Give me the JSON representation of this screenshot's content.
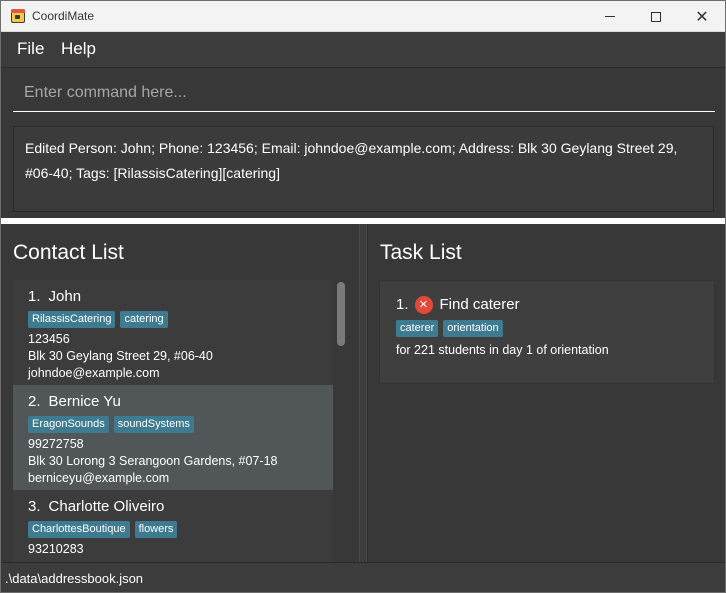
{
  "window": {
    "title": "CoordiMate",
    "icon": "calendar-app-icon"
  },
  "menu": {
    "items": [
      {
        "label": "File"
      },
      {
        "label": "Help"
      }
    ]
  },
  "command": {
    "placeholder": "Enter command here...",
    "value": ""
  },
  "result": {
    "text": "Edited Person: John; Phone: 123456; Email: johndoe@example.com; Address: Blk 30 Geylang Street 29, #06-40; Tags: [RilassisCatering][catering]"
  },
  "contacts": {
    "title": "Contact List",
    "items": [
      {
        "index": "1.",
        "name": "John",
        "tags": [
          "RilassisCatering",
          "catering"
        ],
        "phone": "123456",
        "address": "Blk 30 Geylang Street 29, #06-40",
        "email": "johndoe@example.com"
      },
      {
        "index": "2.",
        "name": "Bernice Yu",
        "tags": [
          "EragonSounds",
          "soundSystems"
        ],
        "phone": "99272758",
        "address": "Blk 30 Lorong 3 Serangoon Gardens, #07-18",
        "email": "berniceyu@example.com"
      },
      {
        "index": "3.",
        "name": "Charlotte Oliveiro",
        "tags": [
          "CharlottesBoutique",
          "flowers"
        ],
        "phone": "93210283",
        "address": "",
        "email": ""
      }
    ]
  },
  "tasks": {
    "title": "Task List",
    "items": [
      {
        "index": "1.",
        "status_icon": "not-done-icon",
        "status_symbol": "✕",
        "name": "Find caterer",
        "tags": [
          "caterer",
          "orientation"
        ],
        "description": "for 221 students in day 1 of orientation"
      }
    ]
  },
  "status": {
    "path": ".\\data\\addressbook.json"
  },
  "colors": {
    "background": "#3c3c3c",
    "tag": "#3e7b91",
    "selected_card": "#515658",
    "not_done": "#e2493b"
  }
}
